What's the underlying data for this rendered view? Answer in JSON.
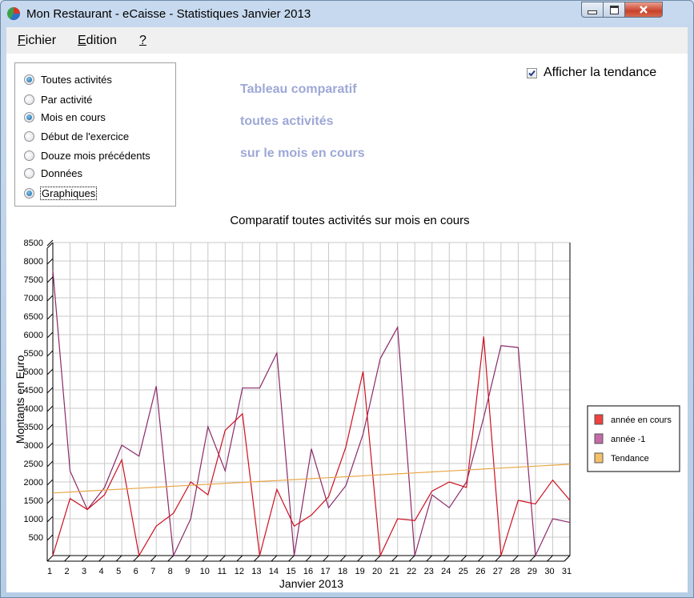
{
  "window": {
    "title": "Mon Restaurant - eCaisse - Statistiques Janvier 2013"
  },
  "menu": {
    "items": [
      {
        "mnemonic": "F",
        "rest": "ichier"
      },
      {
        "mnemonic": "E",
        "rest": "dition"
      },
      {
        "mnemonic": "?",
        "rest": ""
      }
    ]
  },
  "options": {
    "items": [
      {
        "label": "Toutes activités",
        "selected": true
      },
      {
        "label": "Par activité",
        "selected": false
      },
      {
        "label": "Mois en cours",
        "selected": true
      },
      {
        "label": "Début de l'exercice",
        "selected": false
      },
      {
        "label": "Douze mois précédents",
        "selected": false
      },
      {
        "label": "Données",
        "selected": false
      },
      {
        "label": "Graphiques",
        "selected": true
      }
    ]
  },
  "banner": {
    "line1": "Tableau comparatif",
    "line2": "toutes activités",
    "line3": "sur le mois en cours"
  },
  "trend_checkbox": {
    "label": "Afficher la tendance",
    "checked": true
  },
  "colors": {
    "current": "#cc1020",
    "previous": "#8a2a6a",
    "trend": "#e8a84a",
    "grid": "#c8c8c8"
  },
  "chart_data": {
    "type": "line",
    "title": "Comparatif toutes activités sur mois en cours",
    "xlabel": "Janvier 2013",
    "ylabel": "Montants en Euro",
    "x": [
      1,
      2,
      3,
      4,
      5,
      6,
      7,
      8,
      9,
      10,
      11,
      12,
      13,
      14,
      15,
      16,
      17,
      18,
      19,
      20,
      21,
      22,
      23,
      24,
      25,
      26,
      27,
      28,
      29,
      30,
      31
    ],
    "yticks": [
      500,
      1000,
      1500,
      2000,
      2500,
      3000,
      3500,
      4000,
      4500,
      5000,
      5500,
      6000,
      6500,
      7000,
      7500,
      8000,
      8500
    ],
    "ylim": [
      0,
      8500
    ],
    "grid": true,
    "legend_position": "right",
    "series": [
      {
        "name": "année en cours",
        "values": [
          0,
          1550,
          1250,
          1650,
          2600,
          0,
          800,
          1150,
          2000,
          1650,
          3400,
          3850,
          0,
          1800,
          800,
          1100,
          1600,
          2950,
          5000,
          0,
          1000,
          950,
          1750,
          2000,
          1850,
          5950,
          0,
          1500,
          1400,
          2050,
          1500
        ]
      },
      {
        "name": "année -1",
        "values": [
          7750,
          2300,
          1250,
          1850,
          3000,
          2700,
          4600,
          0,
          1000,
          3500,
          2300,
          4550,
          4550,
          5500,
          0,
          2900,
          1300,
          1900,
          3300,
          5350,
          6200,
          0,
          1650,
          1300,
          2000,
          3750,
          5700,
          5650,
          0,
          1000,
          900
        ]
      },
      {
        "name": "Tendance",
        "values": [
          1700,
          1726,
          1752,
          1778,
          1804,
          1830,
          1856,
          1882,
          1908,
          1934,
          1960,
          1986,
          2012,
          2038,
          2064,
          2090,
          2116,
          2142,
          2168,
          2194,
          2220,
          2246,
          2272,
          2298,
          2324,
          2350,
          2376,
          2402,
          2428,
          2454,
          2480
        ]
      }
    ]
  }
}
